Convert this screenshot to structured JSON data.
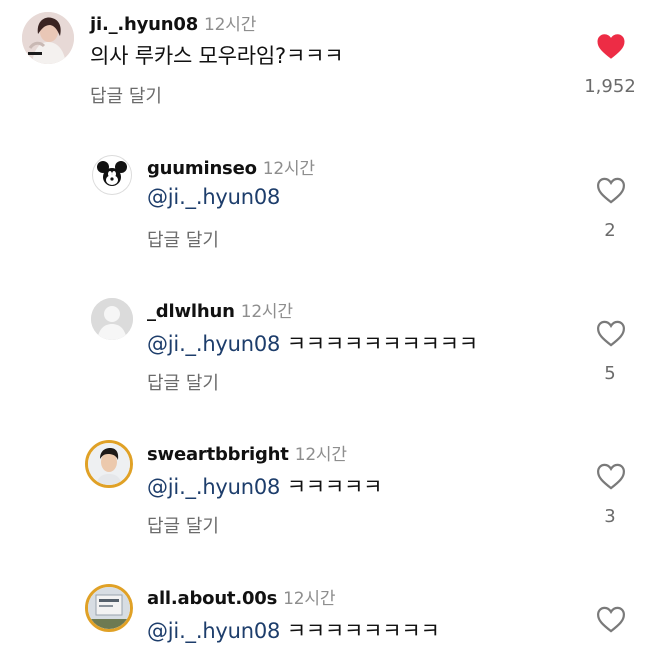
{
  "comments": [
    {
      "username": "ji._.hyun08",
      "time": "12시간",
      "text": "의사 루카스 모우라임?ㅋㅋㅋ",
      "reply_label": "답글 달기",
      "like_count": "1,952",
      "liked": true,
      "avatar_icon": "profile-photo-woman"
    },
    {
      "username": "guuminseo",
      "time": "12시간",
      "mention": "@ji._.hyun08",
      "text": "",
      "reply_label": "답글 달기",
      "like_count": "2",
      "liked": false,
      "avatar_icon": "mickey-mouse-avatar"
    },
    {
      "username": "_dlwlhun",
      "time": "12시간",
      "mention": "@ji._.hyun08",
      "text": "ㅋㅋㅋㅋㅋㅋㅋㅋㅋㅋ",
      "reply_label": "답글 달기",
      "like_count": "5",
      "liked": false,
      "avatar_icon": "default-avatar"
    },
    {
      "username": "sweartbbright",
      "time": "12시간",
      "mention": "@ji._.hyun08",
      "text": "ㅋㅋㅋㅋㅋ",
      "reply_label": "답글 달기",
      "like_count": "3",
      "liked": false,
      "avatar_icon": "profile-photo-man"
    },
    {
      "username": "all.about.00s",
      "time": "12시간",
      "mention": "@ji._.hyun08",
      "text": "ㅋㅋㅋㅋㅋㅋㅋㅋ",
      "liked": false,
      "avatar_icon": "profile-photo-card"
    }
  ],
  "colors": {
    "liked_heart": "#ed2c45",
    "story_ring": "#e0a126"
  }
}
